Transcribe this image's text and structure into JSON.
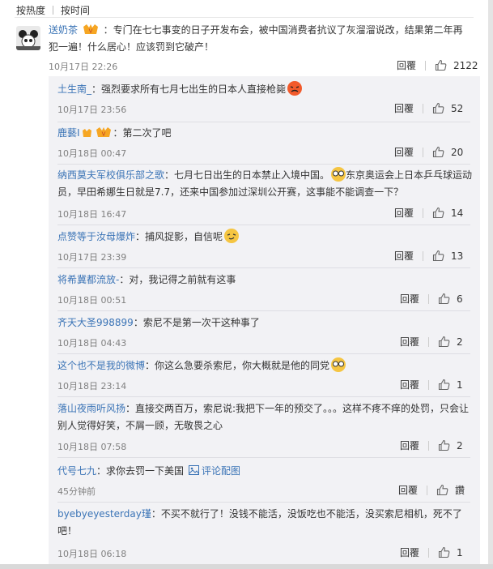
{
  "sort": {
    "hot": "按热度",
    "time": "按时间"
  },
  "main_comment": {
    "username": "送奶茶",
    "text": "：专门在七七事变的日子开发布会，被中国消费者抗议了灰溜溜说改，结果第二年再犯一遍！什么居心！应该罚到它破产！",
    "time": "10月17日 22:26",
    "reply_label": "回覆",
    "likes": "2122"
  },
  "replies": [
    {
      "username": "土生南_",
      "text": "：强烈要求所有七月七出生的日本人直接枪毙",
      "time": "10月17日 23:56",
      "reply_label": "回覆",
      "likes": "52"
    },
    {
      "username": "鹿藝I",
      "text": "：第二次了吧",
      "time": "10月18日 00:47",
      "reply_label": "回覆",
      "likes": "20"
    },
    {
      "username": "纳西莫夫军校俱乐部之歌",
      "text": "：七月七日出生的日本禁止入境中国。",
      "text2": "东京奥运会上日本乒乓球运动员，早田希娜生日就是7.7，还来中国参加过深圳公开赛，这事能不能调查一下？",
      "time": "10月18日 16:47",
      "reply_label": "回覆",
      "likes": "14"
    },
    {
      "username": "点赞等于汝母爆炸",
      "text": "：捕风捉影，自信呢",
      "time": "10月17日 23:39",
      "reply_label": "回覆",
      "likes": "13"
    },
    {
      "username": "将希冀都流放-",
      "text": "：对，我记得之前就有这事",
      "time": "10月18日 00:51",
      "reply_label": "回覆",
      "likes": "6"
    },
    {
      "username": "齐天大圣998899",
      "text": "：索尼不是第一次干这种事了",
      "time": "10月18日 04:43",
      "reply_label": "回覆",
      "likes": "2"
    },
    {
      "username": "这个也不是我的微博",
      "text": "：你这么急要杀索尼，你大概就是他的同党",
      "time": "10月18日 23:14",
      "reply_label": "回覆",
      "likes": "1"
    },
    {
      "username": "落山夜雨听风扬",
      "text": "：直接交两百万，索尼说:我把下一年的预交了。。。这样不疼不痒的处罚，只会让别人觉得好笑，不屑一顾，无敬畏之心",
      "time": "10月18日 07:58",
      "reply_label": "回覆",
      "likes": "2"
    },
    {
      "username": "代号七九",
      "text": "：求你去罚一下美国",
      "pic_link": "评论配图",
      "time": "45分钟前",
      "reply_label": "回覆",
      "likes": "讚"
    },
    {
      "username": "byebyeyesterday瑾",
      "text": "：不买不就行了！没钱不能活，没饭吃也不能活，没买索尼相机，死不了吧！",
      "time": "10月18日 06:18",
      "reply_label": "回覆",
      "likes": "1"
    }
  ]
}
